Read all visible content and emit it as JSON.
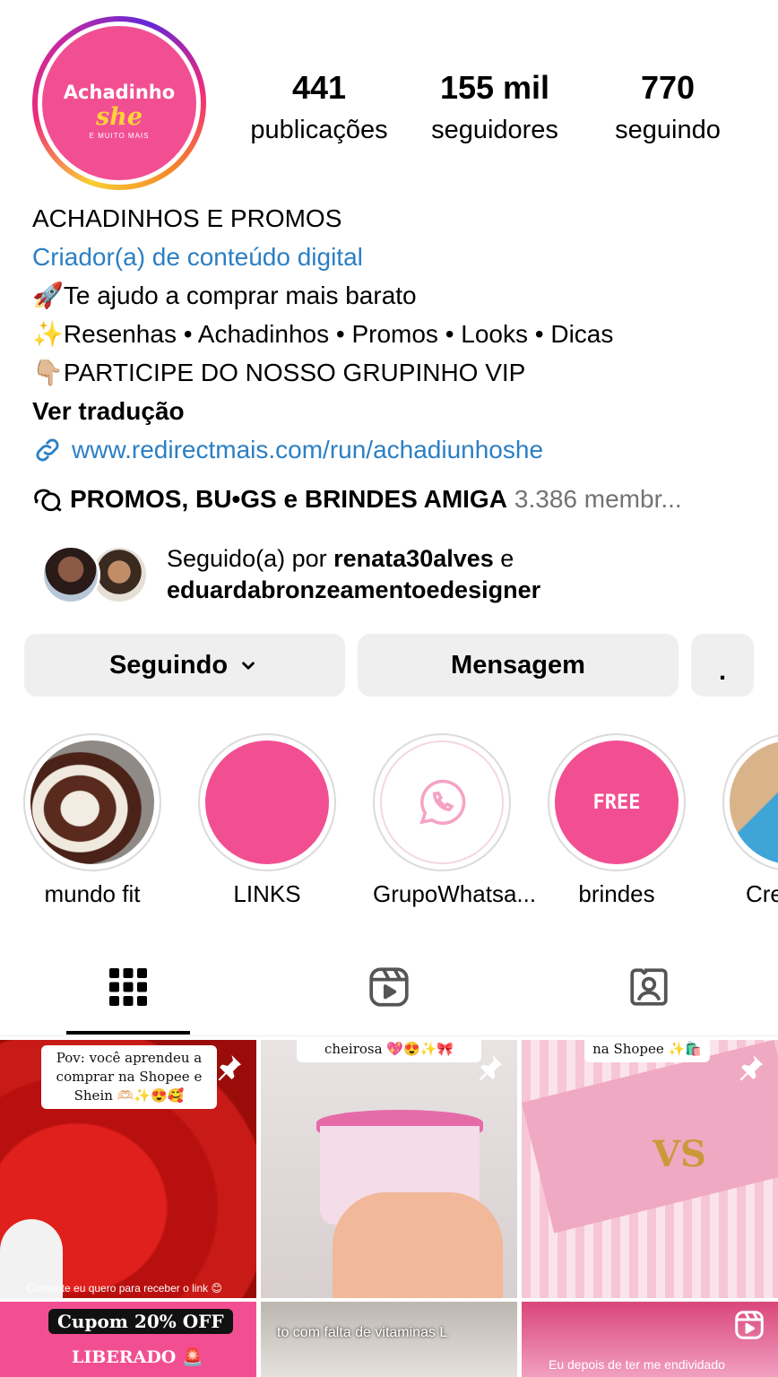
{
  "profile": {
    "avatar_text": "Achadinho",
    "avatar_script": "she",
    "avatar_sub": "E MUITO MAIS",
    "posts_count": "441",
    "posts_label": "publicações",
    "followers_count": "155 mil",
    "followers_label": "seguidores",
    "following_count": "770",
    "following_label": "seguindo"
  },
  "bio": {
    "name": "ACHADINHOS E PROMOS",
    "category": "Criador(a) de conteúdo digital",
    "line1": "🚀Te ajudo a comprar mais barato",
    "line2": "✨Resenhas • Achadinhos • Promos • Looks • Dicas",
    "line3": "👇🏼PARTICIPE DO NOSSO GRUPINHO VIP",
    "translate": "Ver tradução",
    "link": "www.redirectmais.com/run/achadiunhoshe"
  },
  "channel": {
    "name": "PROMOS, BU•GS e BRINDES AMIGA",
    "members": "3.386 membr..."
  },
  "followed_by": {
    "prefix": "Seguido(a) por",
    "user1": "renata30alves",
    "joiner": "e",
    "user2": "eduardabronzeamentoedesigner"
  },
  "actions": {
    "following": "Seguindo",
    "message": "Mensagem",
    "more": "."
  },
  "highlights": [
    {
      "label": "mundo fit"
    },
    {
      "label": "LINKS"
    },
    {
      "label": "GrupoWhatsa..."
    },
    {
      "label": "brindes",
      "badge": "FREE"
    },
    {
      "label": "Cre"
    }
  ],
  "posts": [
    {
      "caption": "Pov: você aprendeu a comprar na Shopee e Shein 🫶🏻✨😍🥰",
      "bottom": "Comente eu quero para receber o link 😊"
    },
    {
      "caption": "cheirosa 💖😍✨🎀"
    },
    {
      "caption": "na Shopee ✨🛍️"
    },
    {
      "caption": "Cupom 20% OFF",
      "caption2": "LIBERADO 🚨"
    },
    {
      "caption": "to com falta de vitaminas L"
    },
    {
      "caption": "Eu depois de ter me endividado"
    }
  ]
}
